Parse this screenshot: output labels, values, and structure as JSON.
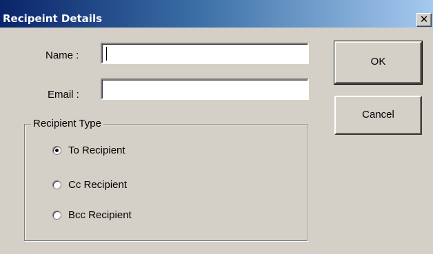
{
  "window": {
    "title": "Recipeint Details",
    "close_glyph": "✕"
  },
  "form": {
    "name_label": "Name :",
    "name_value": "",
    "email_label": "Email :",
    "email_value": ""
  },
  "buttons": {
    "ok_label": "OK",
    "cancel_label": "Cancel"
  },
  "recipient_type": {
    "legend": "Recipient Type",
    "options": [
      {
        "label": "To Recipient",
        "selected": true
      },
      {
        "label": "Cc Recipient",
        "selected": false
      },
      {
        "label": "Bcc Recipient",
        "selected": false
      }
    ]
  },
  "colors": {
    "face": "#d4d0c8",
    "title_start": "#0a246a",
    "title_end": "#a6caf0"
  }
}
